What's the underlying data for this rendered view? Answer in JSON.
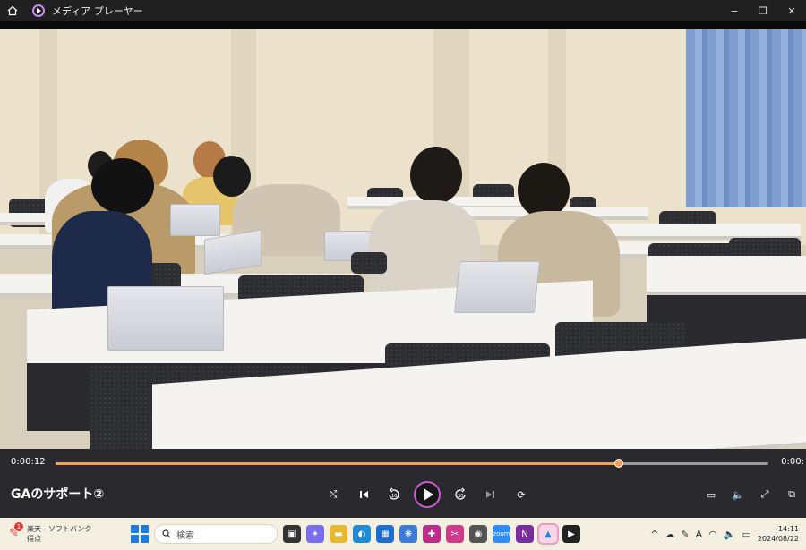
{
  "window": {
    "title": "メディア プレーヤー",
    "controls": {
      "minimize": "−",
      "maximize": "❐",
      "close": "✕"
    }
  },
  "player": {
    "current_time": "0:00:12",
    "total_time": "0:00:",
    "progress_fraction": 0.79,
    "video_title": "GAのサポート②",
    "accent_color": "#f0a05a",
    "buttons": {
      "shuffle_icon": "⤭",
      "previous_icon": "⏮",
      "rewind_label": "10",
      "forward_label": "30",
      "next_icon": "⏭",
      "repeat_icon": "⟳",
      "subtitles_icon": "▭",
      "volume_icon": "🔈",
      "fullscreen_icon": "⤢",
      "miniplayer_icon": "⧉"
    }
  },
  "taskbar": {
    "notification_count": "1",
    "weather_line1": "楽天 - ソフトバンク",
    "weather_line2": "得点",
    "search_placeholder": "検索",
    "apps": [
      {
        "name": "task-view",
        "glyph": "▣",
        "color": "#333"
      },
      {
        "name": "copilot",
        "glyph": "✦",
        "color": "#7a6cf0"
      },
      {
        "name": "file-explorer",
        "glyph": "▬",
        "color": "#e8b830"
      },
      {
        "name": "edge",
        "glyph": "◐",
        "color": "#1f8ad6"
      },
      {
        "name": "store",
        "glyph": "▦",
        "color": "#1c6fd1"
      },
      {
        "name": "photos",
        "glyph": "❋",
        "color": "#3a7dd8"
      },
      {
        "name": "slack",
        "glyph": "✚",
        "color": "#c02a8a"
      },
      {
        "name": "snip",
        "glyph": "✂",
        "color": "#d03a8a"
      },
      {
        "name": "camera",
        "glyph": "◉",
        "color": "#555"
      },
      {
        "name": "zoom",
        "glyph": "zoom",
        "color": "#2d8cff"
      },
      {
        "name": "onenote",
        "glyph": "N",
        "color": "#7a2ba0"
      },
      {
        "name": "photos-app",
        "glyph": "▲",
        "color": "#2c7fd6"
      },
      {
        "name": "media-player",
        "glyph": "▶",
        "color": "#222"
      }
    ],
    "clock_time": "14:11",
    "clock_date": "2024/08/22",
    "tray_text": "A"
  }
}
